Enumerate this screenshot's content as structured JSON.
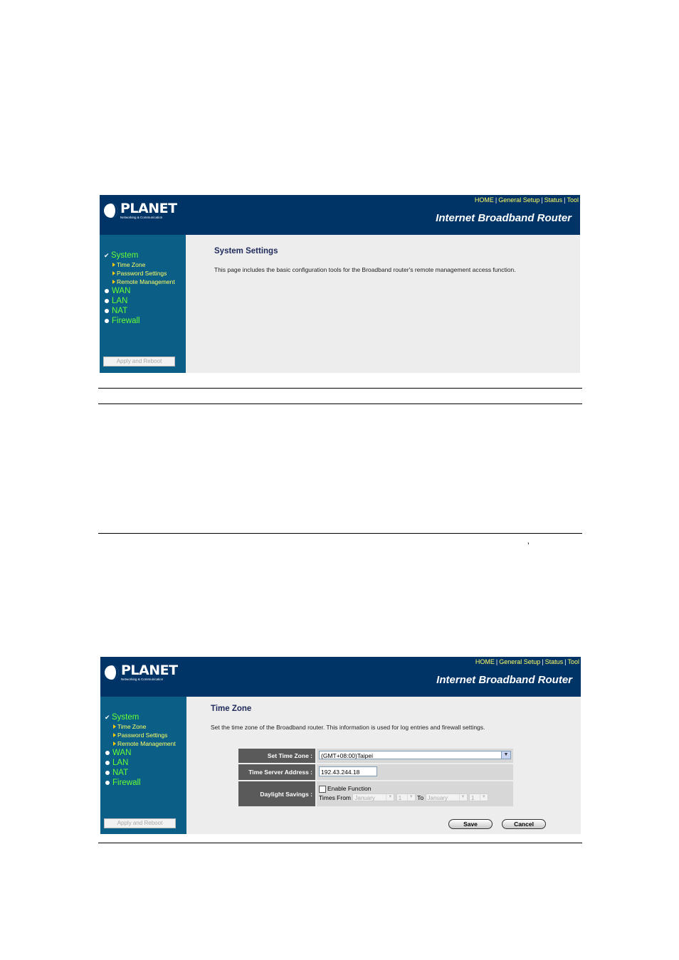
{
  "header": {
    "logo_word": "PLANET",
    "logo_tagline": "Networking & Communication",
    "nav": [
      "HOME",
      "General Setup",
      "Status",
      "Tool"
    ],
    "brand": "Internet Broadband Router"
  },
  "sidebar": {
    "items": [
      {
        "label": "System",
        "subitems": [
          "Time Zone",
          "Password Settings",
          "Remote Management"
        ]
      },
      {
        "label": "WAN"
      },
      {
        "label": "LAN"
      },
      {
        "label": "NAT"
      },
      {
        "label": "Firewall"
      }
    ],
    "apply_button": "Apply and Reboot"
  },
  "screen1": {
    "title": "System Settings",
    "description": "This page includes the basic configuration tools for the Broadband router's remote management access function."
  },
  "screen2": {
    "title": "Time Zone",
    "description": "Set the time zone of the Broadband router. This information is used for log entries and firewall settings.",
    "fields": {
      "time_zone_label": "Set Time Zone :",
      "time_zone_value": "(GMT+08:00)Taipei",
      "server_label": "Time Server Address :",
      "server_value": "192.43.244.18",
      "daylight_label": "Daylight Savings :",
      "enable_label": "Enable Function",
      "times_from": "Times From",
      "from_month": "January",
      "from_day": "1",
      "to_label": "To",
      "to_month": "January",
      "to_day": "1"
    },
    "save_button": "Save",
    "cancel_button": "Cancel"
  },
  "page": {
    "stray_mark": "’"
  },
  "colors": {
    "header_bg": "#003366",
    "sidebar_bg": "#0b5f86",
    "menu_main": "#66ff33",
    "menu_sub": "#ffff66"
  }
}
